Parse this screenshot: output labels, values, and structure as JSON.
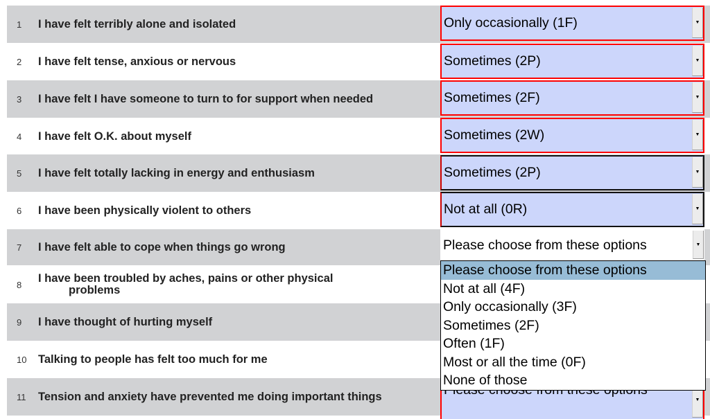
{
  "questions": [
    {
      "num": "1",
      "text": "I have felt terribly alone and isolated",
      "answer": "Only occasionally (1F)"
    },
    {
      "num": "2",
      "text": "I have felt tense, anxious or nervous",
      "answer": "Sometimes (2P)"
    },
    {
      "num": "3",
      "text": "I have felt I have someone to turn to for support when needed",
      "answer": "Sometimes (2F)"
    },
    {
      "num": "4",
      "text": "I have felt O.K. about myself",
      "answer": "Sometimes (2W)"
    },
    {
      "num": "5",
      "text": "I have felt totally lacking in energy and enthusiasm",
      "answer": "Sometimes (2P)"
    },
    {
      "num": "6",
      "text": "I have been physically violent to others",
      "answer": "Not at all (0R)"
    },
    {
      "num": "7",
      "text": "I have felt able to cope when things go wrong",
      "answer": "Please choose from these options"
    },
    {
      "num": "8",
      "text": "I have been troubled by aches, pains or other physical",
      "text_cont": "problems",
      "answer": ""
    },
    {
      "num": "9",
      "text": "I have thought of hurting myself",
      "answer": ""
    },
    {
      "num": "10",
      "text": "Talking to people has felt too much for me",
      "answer": ""
    },
    {
      "num": "11",
      "text": "Tension and anxiety have prevented me doing important things",
      "answer": "Please choose from these options"
    }
  ],
  "dropdown": {
    "options": [
      "Please choose from these options",
      "Not at all (4F)",
      "Only occasionally (3F)",
      "Sometimes (2F)",
      "Often (1F)",
      "Most or all the time (0F)",
      "None of those"
    ],
    "highlighted_index": 0
  },
  "colors": {
    "answered_bg": "#ccd6fb",
    "error_border": "#ff0000",
    "row_shade": "#d1d2d4",
    "highlight": "#97bcd6"
  }
}
